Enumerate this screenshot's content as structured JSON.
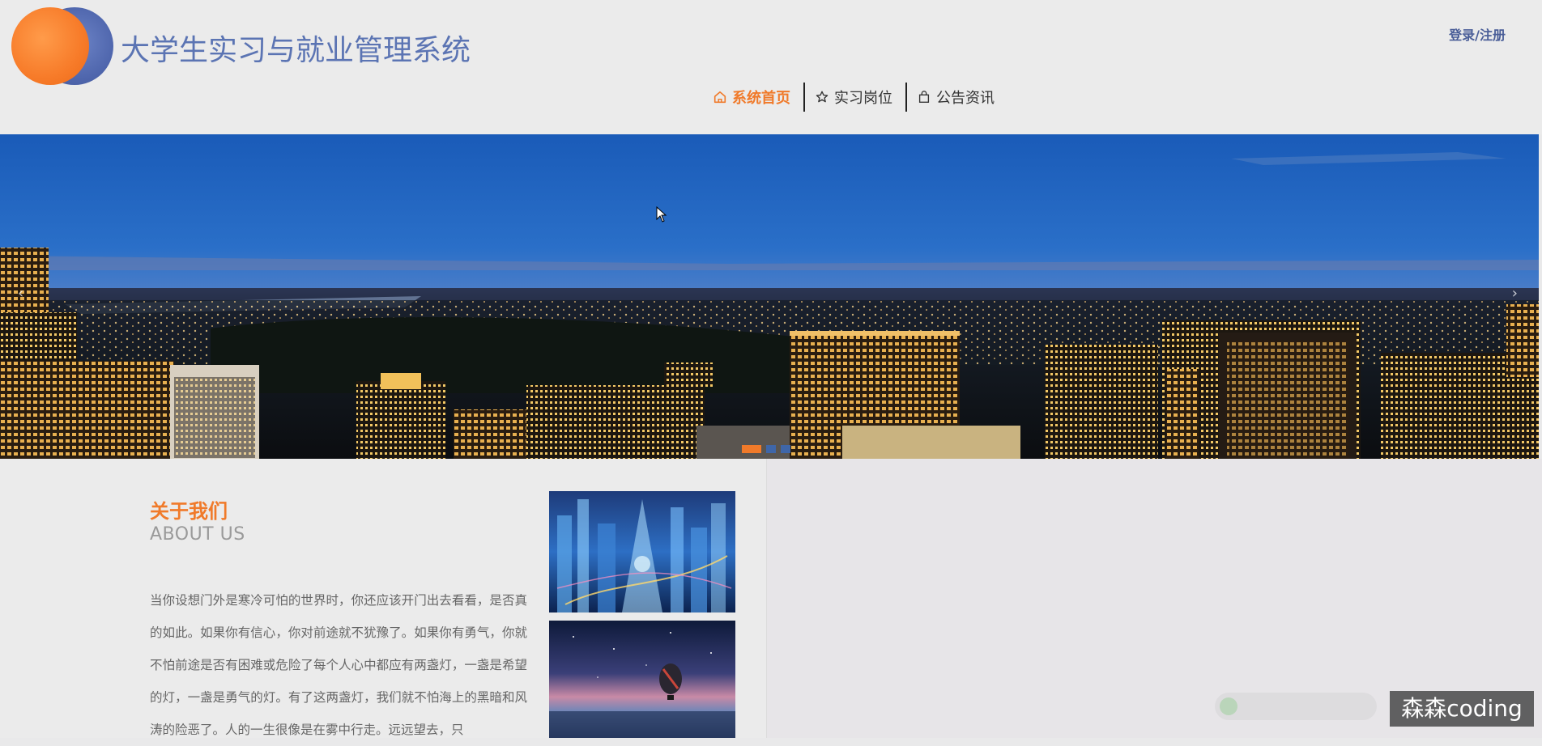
{
  "header": {
    "site_title": "大学生实习与就业管理系统",
    "login_label": "登录/注册"
  },
  "nav": {
    "items": [
      {
        "label": "系统首页",
        "icon": "home-icon",
        "active": true
      },
      {
        "label": "实习岗位",
        "icon": "star-icon",
        "active": false
      },
      {
        "label": "公告资讯",
        "icon": "bag-icon",
        "active": false
      }
    ]
  },
  "banner": {
    "prev_glyph": "‹",
    "next_glyph": "›",
    "slides": 3,
    "active_slide": 1
  },
  "about": {
    "title": "关于我们",
    "subtitle": "ABOUT US",
    "text": "当你设想门外是寒冷可怕的世界时，你还应该开门出去看看，是否真的如此。如果你有信心，你对前途就不犹豫了。如果你有勇气，你就不怕前途是否有困难或危险了每个人心中都应有两盏灯，一盏是希望的灯，一盏是勇气的灯。有了这两盏灯，我们就不怕海上的黑暗和风涛的险恶了。人的一生很像是在雾中行走。远远望去，只"
  },
  "watermark": {
    "text": "森森coding"
  },
  "colors": {
    "accent": "#f07a2a",
    "title_blue": "#5b74b3",
    "dot_inactive": "#3f66a8"
  }
}
